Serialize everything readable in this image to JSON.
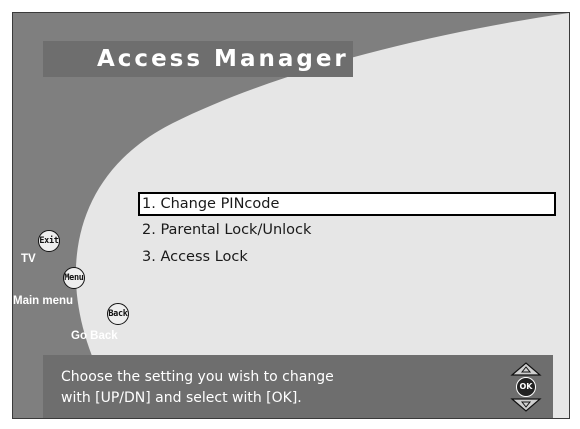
{
  "title": "Access Manager",
  "menu": {
    "items": [
      {
        "label": "1. Change PINcode",
        "selected": true
      },
      {
        "label": "2. Parental Lock/Unlock",
        "selected": false
      },
      {
        "label": "3. Access Lock",
        "selected": false
      }
    ]
  },
  "remote": {
    "exit_key": "Exit",
    "exit_label": "TV",
    "menu_key": "Menu",
    "menu_label": "Main menu",
    "back_key": "Back",
    "back_label": "Go Back"
  },
  "instructions": {
    "line1": "Choose the setting you wish to change",
    "line2": "with [UP/DN] and select with [OK]."
  },
  "nav": {
    "ok_key": "OK"
  },
  "colors": {
    "background": "#7f7f7f",
    "swoosh": "#e6e6e6",
    "bar": "#6e6e6e",
    "highlight": "#ffffff"
  }
}
